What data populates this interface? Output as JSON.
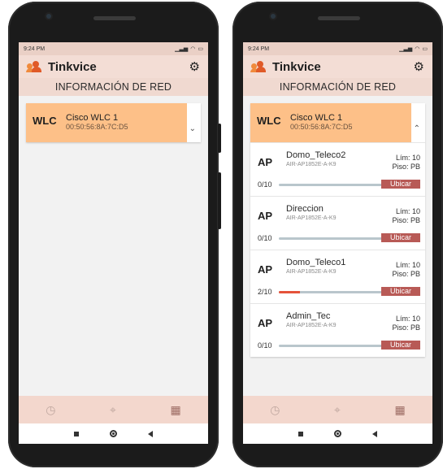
{
  "screens": [
    {
      "status_time": "9:24 PM",
      "app_title": "Tinkvice",
      "section_title": "INFORMACIÓN DE RED",
      "wlc": {
        "type": "WLC",
        "name": "Cisco WLC 1",
        "mac": "00:50:56:8A:7C:D5",
        "expanded": false,
        "chevron": "⌄"
      },
      "aps": []
    },
    {
      "status_time": "9:24 PM",
      "app_title": "Tinkvice",
      "section_title": "INFORMACIÓN DE RED",
      "wlc": {
        "type": "WLC",
        "name": "Cisco WLC 1",
        "mac": "00:50:56:8A:7C:D5",
        "expanded": true,
        "chevron": "⌃"
      },
      "aps": [
        {
          "type": "AP",
          "name": "Domo_Teleco2",
          "model": "AIR-AP1852E-A-K9",
          "lim": "Lím: 10",
          "piso": "Piso: PB",
          "count": "0/10",
          "progress": 0,
          "button": "Ubicar"
        },
        {
          "type": "AP",
          "name": "Direccion",
          "model": "AIR-AP1852E-A-K9",
          "lim": "Lím: 10",
          "piso": "Piso: PB",
          "count": "0/10",
          "progress": 0,
          "button": "Ubicar"
        },
        {
          "type": "AP",
          "name": "Domo_Teleco1",
          "model": "AIR-AP1852E-A-K9",
          "lim": "Lím: 10",
          "piso": "Piso: PB",
          "count": "2/10",
          "progress": 0.2,
          "button": "Ubicar"
        },
        {
          "type": "AP",
          "name": "Admin_Tec",
          "model": "AIR-AP1852E-A-K9",
          "lim": "Lím: 10",
          "piso": "Piso: PB",
          "count": "0/10",
          "progress": 0,
          "button": "Ubicar"
        }
      ]
    }
  ],
  "icons": {
    "gear": "⚙",
    "history": "◷",
    "crosshair": "⌖",
    "building": "▦"
  },
  "colors": {
    "wlc_header": "#fdc088",
    "ubicar_button": "#b85a56",
    "progress_fill": "#e5533a",
    "app_bar": "#f3ddd5"
  }
}
